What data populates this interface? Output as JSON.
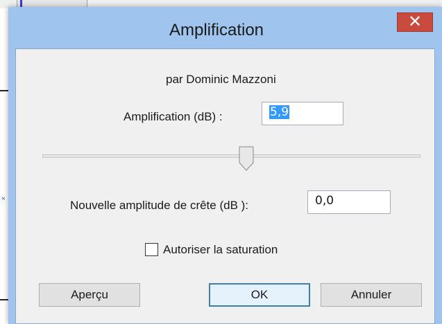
{
  "window": {
    "title": "Amplification",
    "close_glyph": "✕"
  },
  "plugin": {
    "author": "par Dominic Mazzoni"
  },
  "amplification": {
    "label": "Amplification (dB) :",
    "value": "5,9"
  },
  "slider": {
    "position_fraction": 0.54
  },
  "peak": {
    "label": "Nouvelle amplitude de crête (dB ):",
    "value": "0,0"
  },
  "saturation": {
    "label": "Autoriser la saturation",
    "checked": false
  },
  "buttons": {
    "preview": "Aperçu",
    "ok": "OK",
    "cancel": "Annuler"
  },
  "colors": {
    "frame": "#9fc4ed",
    "close": "#c94a3e",
    "selection": "#3399ff",
    "default_button_border": "#3c7fb1"
  }
}
